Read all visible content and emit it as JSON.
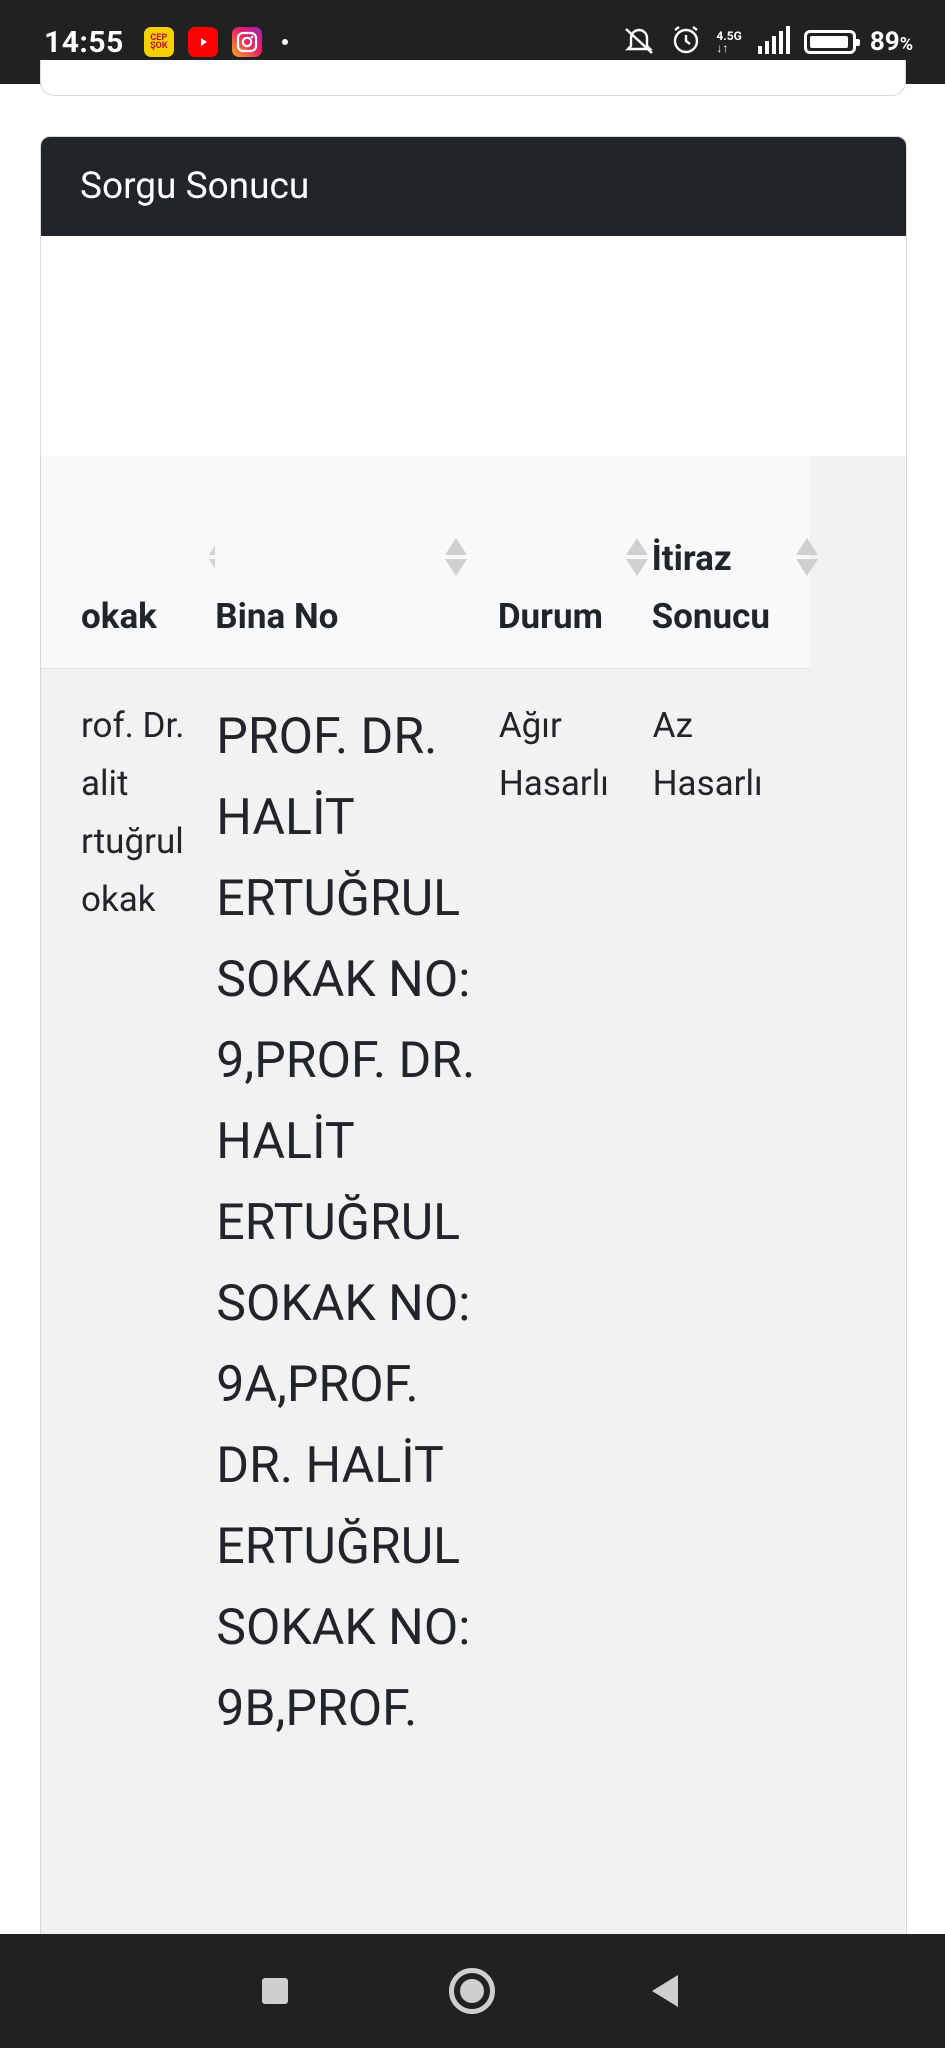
{
  "status_bar": {
    "time": "14:55",
    "apps": [
      "cepte-sok-app-icon",
      "youtube-app-icon",
      "instagram-app-icon"
    ],
    "network_top": "4.5G",
    "network_bottom": "↓↑",
    "battery_level": 0.89,
    "battery_percent": "89",
    "percent_sign": "%"
  },
  "card": {
    "title": "Sorgu Sonucu"
  },
  "table": {
    "columns": [
      {
        "key": "sokak",
        "label": "okak"
      },
      {
        "key": "bina_no",
        "label": "Bina No"
      },
      {
        "key": "durum",
        "label": "Durum"
      },
      {
        "key": "itiraz",
        "label_line1": "İtiraz",
        "label_line2": "Sonucu"
      }
    ],
    "rows": [
      {
        "sokak": "rof. Dr. alit rtuğrul okak",
        "bina_no": "PROF. DR. HALİT ERTUĞRUL SOKAK NO: 9,PROF. DR. HALİT ERTUĞRUL SOKAK NO: 9A,PROF. DR. HALİT ERTUĞRUL SOKAK NO: 9B,PROF.",
        "durum": "Ağır Hasarlı",
        "itiraz": "Az Hasarlı"
      }
    ]
  },
  "colors": {
    "header_dark": "#212529",
    "status_bar": "#212121",
    "table_row_bg": "#f2f2f2",
    "table_head_bg": "#f8f9fa"
  },
  "nav": {
    "icons": [
      "recent-apps-icon",
      "home-icon",
      "back-icon"
    ]
  }
}
